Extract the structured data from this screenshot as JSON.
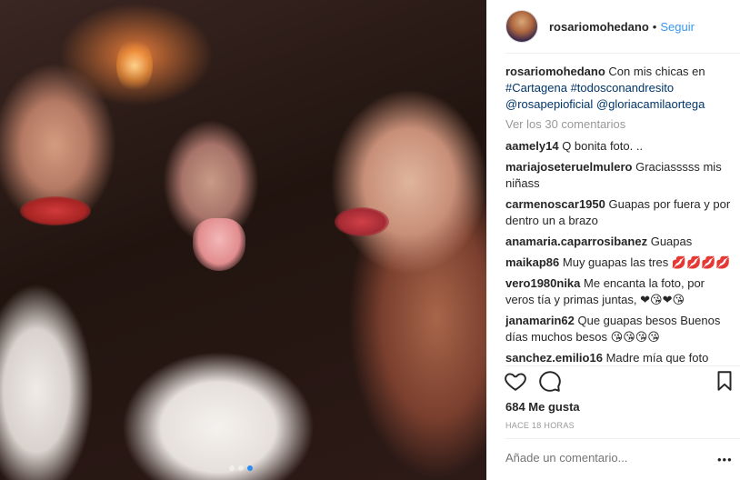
{
  "post": {
    "username": "rosariomohedano",
    "separator": "•",
    "follow_label": "Seguir",
    "caption": {
      "username": "rosariomohedano",
      "text": "Con mis chicas en",
      "tags": [
        "#Cartagena",
        "#todosconandresito",
        "@rosapepioficial",
        "@gloriacamilaortega"
      ]
    },
    "view_all": "Ver los 30 comentarios",
    "comments": [
      {
        "user": "aamely14",
        "text": "Q bonita foto. ..",
        "emojis": ""
      },
      {
        "user": "mariajoseteruelmulero",
        "text": "Graciasssss mis niñass",
        "emojis": ""
      },
      {
        "user": "carmenoscar1950",
        "text": "Guapas por fuera y por dentro un a brazo",
        "emojis": ""
      },
      {
        "user": "anamaria.caparrosibanez",
        "text": "Guapas",
        "emojis": ""
      },
      {
        "user": "maikap86",
        "text": "Muy guapas las tres",
        "emojis": "💋💋💋💋"
      },
      {
        "user": "vero1980nika",
        "text": "Me encanta la foto, por veros tía y primas juntas,",
        "emojis": "❤😘❤😘"
      },
      {
        "user": "janamarin62",
        "text": "Que guapas besos Buenos días muchos besos",
        "emojis": "😘😘😘😘"
      },
      {
        "user": "sanchez.emilio16",
        "text": "Madre mía que foto",
        "emojis": ""
      }
    ],
    "likes": "684 Me gusta",
    "time": "HACE 18 HORAS",
    "add_comment_placeholder": "Añade un comentario...",
    "more_label": "•••"
  },
  "icons": {
    "like": "heart-icon",
    "comment": "speech-bubble-icon",
    "save": "bookmark-icon"
  },
  "colors": {
    "link": "#003569",
    "follow": "#3897f0",
    "muted": "#999999",
    "carousel_active": "#2b8cf2"
  },
  "carousel": {
    "count": 3,
    "active_index": 2
  }
}
